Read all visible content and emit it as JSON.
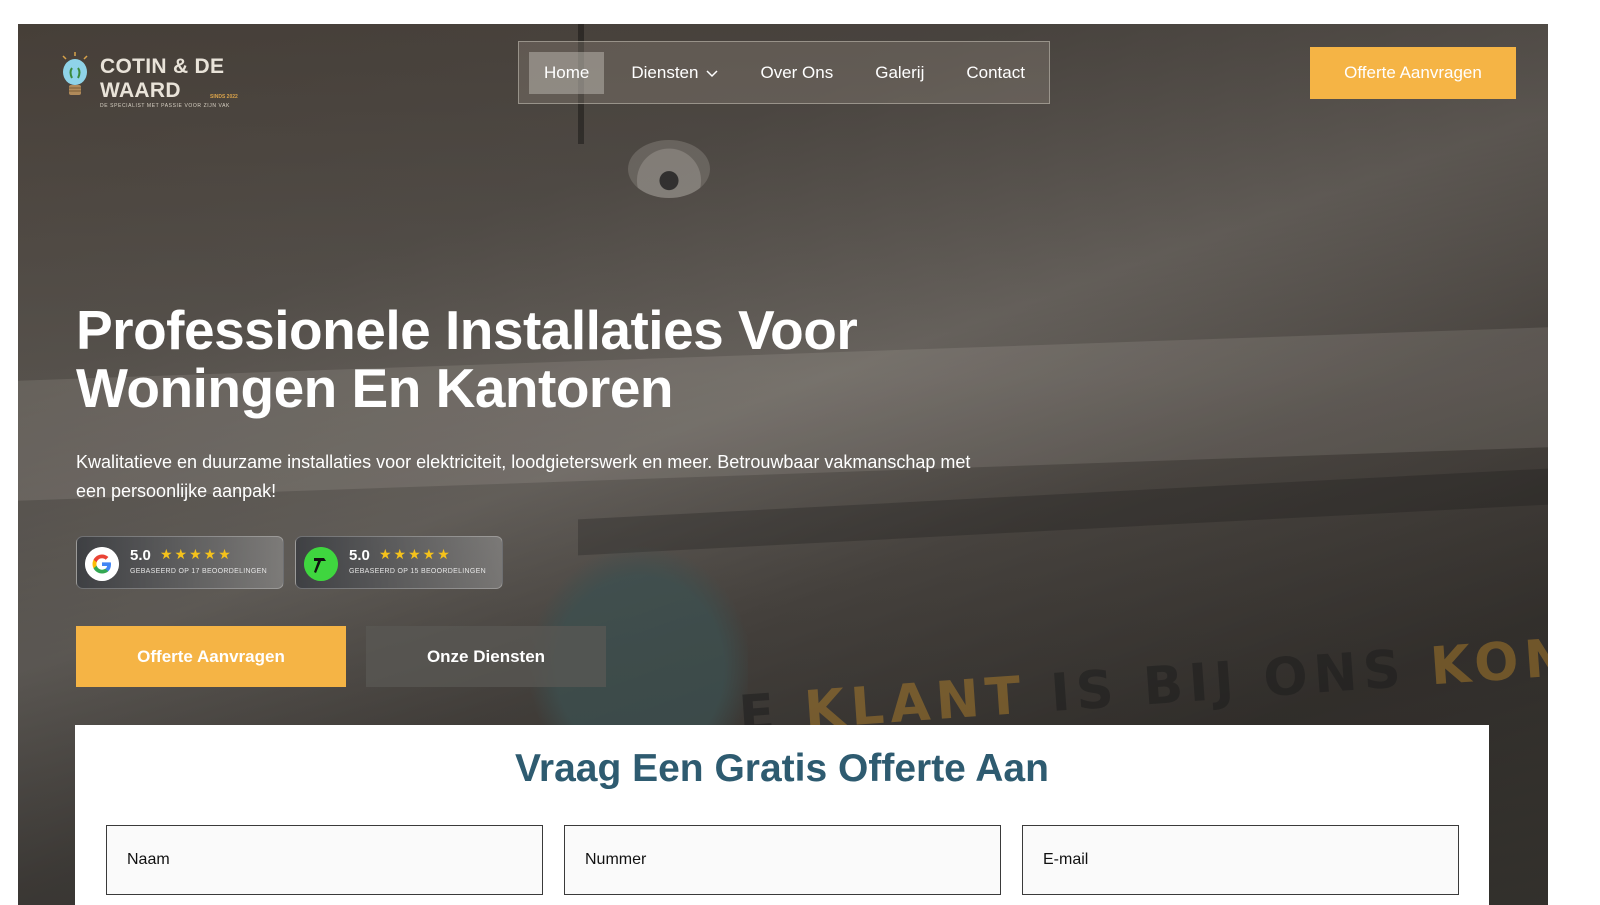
{
  "brand": {
    "name_line1": "COTIN & DE",
    "name_line2": "WAARD",
    "since": "SINDS 2022",
    "tagline": "DE SPECIALIST MET PASSIE VOOR ZIJN VAK",
    "logo_icon": "lightbulb-icon"
  },
  "nav": {
    "items": [
      {
        "label": "Home",
        "active": true
      },
      {
        "label": "Diensten",
        "has_dropdown": true
      },
      {
        "label": "Over Ons"
      },
      {
        "label": "Galerij"
      },
      {
        "label": "Contact"
      }
    ],
    "cta_label": "Offerte Aanvragen"
  },
  "hero": {
    "title": "Professionele Installaties Voor Woningen En Kantoren",
    "subtitle": "Kwalitatieve en duurzame installaties voor elektriciteit, loodgieterswerk en meer. Betrouwbaar vakmanschap met een persoonlijke aanpak!",
    "background_wall_text": [
      "E",
      "KLANT",
      "IS BIJ ONS",
      "KONIN"
    ],
    "reviews": [
      {
        "platform_icon": "google-icon",
        "score": "5.0",
        "stars": 5,
        "based_on": "GEBASEERD OP 17 BEOORDELINGEN"
      },
      {
        "platform_icon": "hammer-icon",
        "score": "5.0",
        "stars": 5,
        "based_on": "GEBASEERD OP 15 BEOORDELINGEN"
      }
    ],
    "primary_button": "Offerte Aanvragen",
    "secondary_button": "Onze Diensten"
  },
  "quote_form": {
    "title": "Vraag Een Gratis Offerte Aan",
    "fields": [
      {
        "placeholder": "Naam",
        "value": ""
      },
      {
        "placeholder": "Nummer",
        "value": ""
      },
      {
        "placeholder": "E-mail",
        "value": ""
      }
    ]
  },
  "colors": {
    "accent": "#f5b445",
    "heading": "#2e5b70",
    "star": "#f5c21b"
  }
}
